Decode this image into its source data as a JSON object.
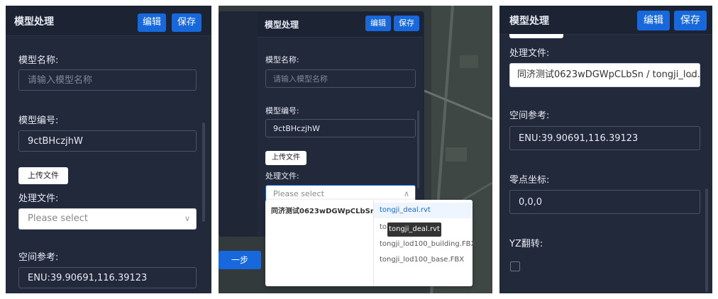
{
  "left": {
    "title": "模型处理",
    "edit_label": "编辑",
    "save_label": "保存",
    "name_label": "模型名称:",
    "name_placeholder": "请输入模型名称",
    "code_label": "模型编号:",
    "code_value": "9ctBHczjhW",
    "upload_label": "上传文件",
    "file_label": "处理文件:",
    "file_placeholder": "Please select",
    "ref_label": "空间参考:",
    "ref_value": "ENU:39.90691,116.39123"
  },
  "middle": {
    "title": "模型处理",
    "edit_label": "编辑",
    "save_label": "保存",
    "name_label": "模型名称:",
    "name_placeholder": "请输入模型名称",
    "code_label": "模型编号:",
    "code_value": "9ctBHczjhW",
    "upload_label": "上传文件",
    "file_label": "处理文件:",
    "file_placeholder": "Please select",
    "prev_label": "一步",
    "cascader": {
      "folder": "同济测试0623wDGWpCLbSn",
      "files": [
        "tongji_deal.rvt",
        "to",
        "tongji_lod100_building.FBX",
        "tongji_lod100_base.FBX"
      ],
      "tooltip": "tongji_deal.rvt"
    }
  },
  "right": {
    "title": "模型处理",
    "edit_label": "编辑",
    "save_label": "保存",
    "file_label": "处理文件:",
    "file_value": "同济测试0623wDGWpCLbSn / tongji_lod...",
    "ref_label": "空间参考:",
    "ref_value": "ENU:39.90691,116.39123",
    "zero_label": "零点坐标:",
    "zero_value": "0,0,0",
    "yz_label": "YZ翻转:"
  }
}
